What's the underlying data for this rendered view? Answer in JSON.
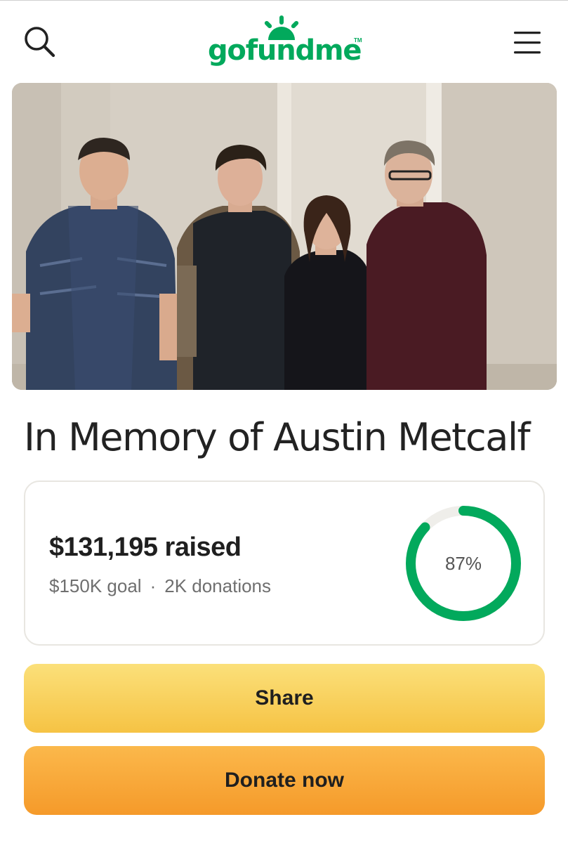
{
  "header": {
    "logo_text": "gofundme",
    "logo_tm": "TM",
    "brand_color": "#02a95c",
    "search_icon": "search-icon",
    "menu_icon": "hamburger-menu-icon"
  },
  "campaign": {
    "title": "In Memory of Austin Metcalf",
    "raised_text": "$131,195 raised",
    "goal_text": "$150K goal",
    "separator": "·",
    "donations_text": "2K donations",
    "progress_label": "87%",
    "progress_fraction": 0.87,
    "progress_color": "#02a95c",
    "track_color": "#efeeea"
  },
  "actions": {
    "share_label": "Share",
    "donate_label": "Donate now"
  }
}
